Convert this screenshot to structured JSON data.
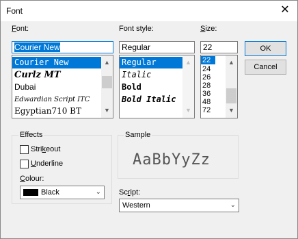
{
  "window": {
    "title": "Font",
    "close_glyph": "✕"
  },
  "font": {
    "label_prefix": "",
    "label_ul": "F",
    "label_rest": "ont:",
    "value": "Courier New",
    "items": [
      "Courier New",
      "Curlz MT",
      "Dubai",
      "Edwardian Script ITC",
      "Egyptian710 BT"
    ]
  },
  "style": {
    "label": "Font style:",
    "value": "Regular",
    "items": [
      "Regular",
      "Italic",
      "Bold",
      "Bold Italic"
    ]
  },
  "size": {
    "label_ul": "S",
    "label_rest": "ize:",
    "value": "22",
    "items": [
      "22",
      "24",
      "26",
      "28",
      "36",
      "48",
      "72"
    ]
  },
  "buttons": {
    "ok": "OK",
    "cancel": "Cancel"
  },
  "effects": {
    "title": "Effects",
    "strikeout_pre": "Stri",
    "strikeout_ul": "k",
    "strikeout_post": "eout",
    "underline_ul": "U",
    "underline_post": "nderline",
    "colour_ul": "C",
    "colour_post": "olour:",
    "colour_value": "Black",
    "colour_hex": "#000000"
  },
  "sample": {
    "title": "Sample",
    "text": "AaBbYyZz"
  },
  "script": {
    "label_pre": "Sc",
    "label_ul": "r",
    "label_post": "ipt:",
    "value": "Western"
  },
  "icons": {
    "up": "▲",
    "down": "▼",
    "chevron": "⌄"
  },
  "colors": {
    "accent": "#0078d7",
    "dialog_bg": "#f0f0f0"
  }
}
